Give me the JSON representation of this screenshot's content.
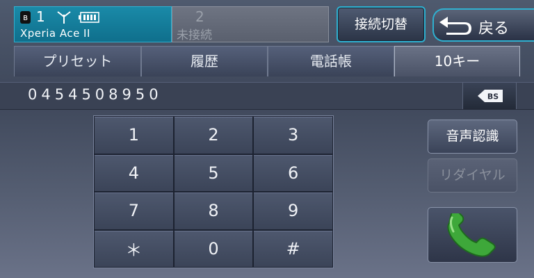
{
  "header": {
    "device1": {
      "number": "1",
      "name": "Xperia Ace II",
      "bluetooth_icon": "bluetooth-icon",
      "signal_icon": "antenna-icon",
      "battery_icon": "battery-icon"
    },
    "device2": {
      "number": "2",
      "status": "未接続"
    },
    "switch_label": "接続切替",
    "back_label": "戻る"
  },
  "tabs": [
    {
      "label": "プリセット",
      "active": false
    },
    {
      "label": "履歴",
      "active": false
    },
    {
      "label": "電話帳",
      "active": false
    },
    {
      "label": "10キー",
      "active": true
    }
  ],
  "number_display": {
    "value": "0454508950",
    "backspace_label": "BS"
  },
  "keypad": {
    "keys": [
      "1",
      "2",
      "3",
      "4",
      "5",
      "6",
      "7",
      "8",
      "9",
      "＊",
      "0",
      "#"
    ]
  },
  "side": {
    "voice_label": "音声認識",
    "redial_label": "リダイヤル",
    "call_icon": "phone-call-icon"
  },
  "colors": {
    "accent": "#2fb0d0",
    "active_device": "#1a8aa8",
    "call_green": "#3ea83a"
  }
}
